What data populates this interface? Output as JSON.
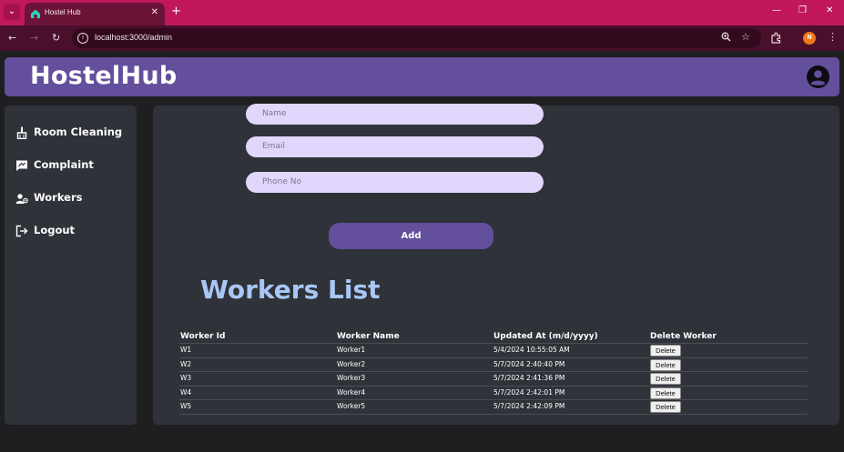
{
  "browser": {
    "tab_title": "Hostel Hub",
    "tab_close": "✕",
    "new_tab": "+",
    "url": "localhost:3000/admin",
    "profile_initial": "N"
  },
  "app": {
    "brand": "HostelHub",
    "accent_color": "#634f9b"
  },
  "sidebar": {
    "items": [
      {
        "label": "Room Cleaning",
        "icon": "broom-icon"
      },
      {
        "label": "Complaint",
        "icon": "message-icon"
      },
      {
        "label": "Workers",
        "icon": "worker-icon"
      },
      {
        "label": "Logout",
        "icon": "logout-icon"
      }
    ]
  },
  "form": {
    "name_placeholder": "Name",
    "email_placeholder": "Email",
    "phone_placeholder": "Phone No",
    "add_label": "Add"
  },
  "workers": {
    "title": "Workers List",
    "columns": [
      "Worker Id",
      "Worker Name",
      "Updated At (m/d/yyyy)",
      "Delete Worker"
    ],
    "delete_label": "Delete",
    "rows": [
      {
        "id": "W1",
        "name": "Worker1",
        "updated": "5/4/2024 10:55:05 AM"
      },
      {
        "id": "W2",
        "name": "Worker2",
        "updated": "5/7/2024 2:40:40 PM"
      },
      {
        "id": "W3",
        "name": "Worker3",
        "updated": "5/7/2024 2:41:36 PM"
      },
      {
        "id": "W4",
        "name": "Worker4",
        "updated": "5/7/2024 2:42:01 PM"
      },
      {
        "id": "W5",
        "name": "Worker5",
        "updated": "5/7/2024 2:42:09 PM"
      }
    ]
  }
}
